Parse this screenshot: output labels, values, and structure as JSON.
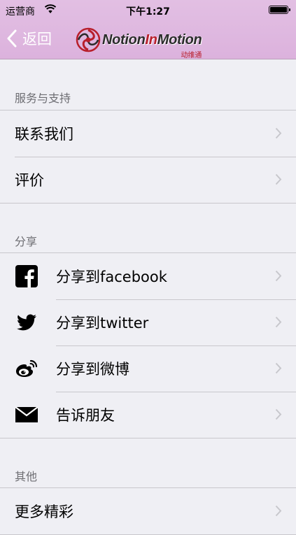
{
  "status_bar": {
    "carrier": "运营商",
    "time": "下午1:27"
  },
  "nav": {
    "back_label": "返回",
    "logo": {
      "name_part1": "Notion",
      "name_part2": "In",
      "name_part3": "Motion",
      "subtitle": "动维通"
    }
  },
  "colors": {
    "nav_background": "#dcb2dd",
    "brand_red": "#b81f2c",
    "page_background": "#efeff4"
  },
  "sections": [
    {
      "header": "服务与支持",
      "items": [
        {
          "label": "联系我们"
        },
        {
          "label": "评价"
        }
      ]
    },
    {
      "header": "分享",
      "items": [
        {
          "label": "分享到facebook",
          "icon": "facebook-icon"
        },
        {
          "label": "分享到twitter",
          "icon": "twitter-icon"
        },
        {
          "label": "分享到微博",
          "icon": "weibo-icon"
        },
        {
          "label": "告诉朋友",
          "icon": "mail-icon"
        }
      ]
    },
    {
      "header": "其他",
      "items": [
        {
          "label": "更多精彩"
        }
      ]
    }
  ]
}
